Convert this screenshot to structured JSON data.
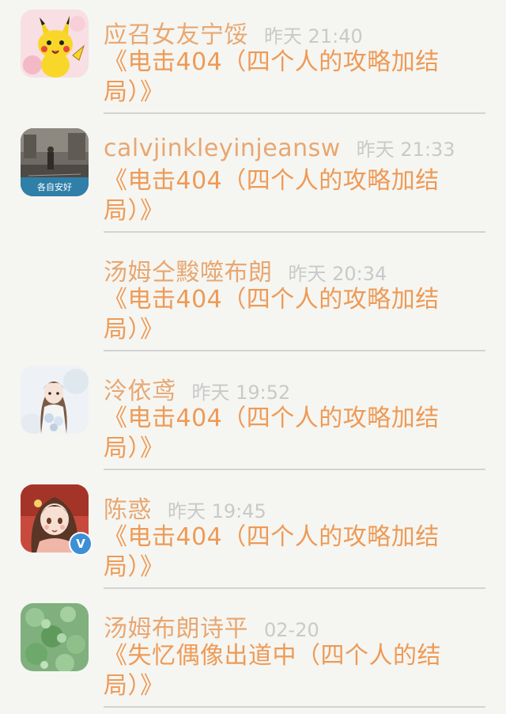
{
  "comments": [
    {
      "name": "应召女友宁馁",
      "time": "昨天 21:40",
      "content": "《电击404（四个人的攻略加结局）》",
      "avatar": "pikachu-avatar"
    },
    {
      "name": "calvjinkleyinjeansw",
      "time": "昨天 21:33",
      "content": "《电击404（四个人的攻略加结局）》",
      "avatar": "street-photo-avatar",
      "avatar_caption": "各自安好"
    },
    {
      "name": "汤姆仝黢噬布朗",
      "time": "昨天 20:34",
      "content": "《电击404（四个人的攻略加结局）》",
      "avatar": "empty-avatar"
    },
    {
      "name": "泠依鸢",
      "time": "昨天 19:52",
      "content": "《电击404（四个人的攻略加结局）》",
      "avatar": "anime-girl-flowers-avatar"
    },
    {
      "name": "陈惑",
      "time": "昨天 19:45",
      "content": "《电击404（四个人的攻略加结局）》",
      "avatar": "anime-girl-avatar",
      "verified_label": "V"
    },
    {
      "name": "汤姆布朗诗平",
      "time": "02-20",
      "content": "《失忆偶像出道中（四个人的结局）》",
      "avatar": "clover-avatar"
    }
  ],
  "colors": {
    "background": "#f5f6f2",
    "name": "#e8a771",
    "time": "#c9c9c9",
    "content": "#ee9a56",
    "divider": "#d3d3d3",
    "verified": "#3d8fd6"
  }
}
